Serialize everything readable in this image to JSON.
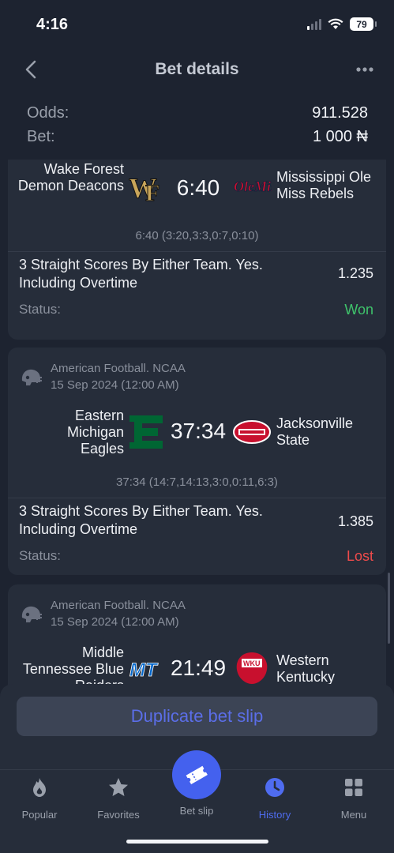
{
  "status_bar": {
    "time": "4:16",
    "battery": "79",
    "icons": [
      "signal-icon",
      "wifi-icon",
      "battery-icon"
    ]
  },
  "header": {
    "title": "Bet details",
    "back_icon": "chevron-left-icon",
    "more_icon": "more-horizontal-icon"
  },
  "summary": {
    "odds_label": "Odds:",
    "odds_value": "911.528",
    "bet_label": "Bet:",
    "bet_value": "1 000 ₦"
  },
  "bets": [
    {
      "team_home": "Wake Forest Demon Deacons",
      "team_away": "Mississippi Ole Miss Rebels",
      "score": "6:40",
      "detail_score": "6:40 (3:20,3:3,0:7,0:10)",
      "market": "3 Straight Scores By Either Team. Yes. Including Overtime",
      "odd": "1.235",
      "status_label": "Status:",
      "status": "Won"
    },
    {
      "league": "American Football. NCAA",
      "date": "15 Sep 2024 (12:00 AM)",
      "team_home": "Eastern Michigan Eagles",
      "team_away": "Jacksonville State",
      "score": "37:34",
      "detail_score": "37:34 (14:7,14:13,3:0,0:11,6:3)",
      "market": "3 Straight Scores By Either Team. Yes. Including Overtime",
      "odd": "1.385",
      "status_label": "Status:",
      "status": "Lost"
    },
    {
      "league": "American Football. NCAA",
      "date": "15 Sep 2024 (12:00 AM)",
      "team_home": "Middle Tennessee Blue Raiders",
      "team_away": "Western Kentucky Hilltoppers",
      "score": "21:49"
    }
  ],
  "actions": {
    "duplicate": "Duplicate bet slip"
  },
  "tabs": [
    {
      "label": "Popular",
      "icon": "flame-icon"
    },
    {
      "label": "Favorites",
      "icon": "star-icon"
    },
    {
      "label": "Bet slip",
      "icon": "ticket-icon"
    },
    {
      "label": "History",
      "icon": "clock-icon",
      "active": true
    },
    {
      "label": "Menu",
      "icon": "grid-icon"
    }
  ],
  "colors": {
    "accent": "#4461ee",
    "won": "#3fc36b",
    "lost": "#ef4b4b",
    "background": "#1d2330",
    "card": "#262d3a"
  }
}
